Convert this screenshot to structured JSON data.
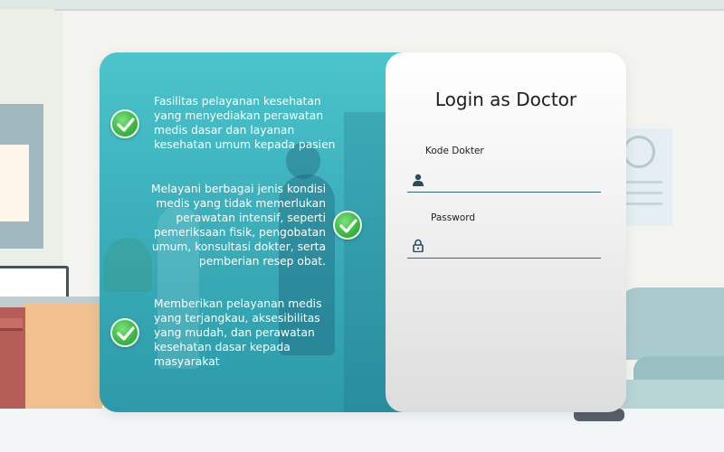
{
  "colors": {
    "info_gradient_top": "#4cc4cb",
    "info_gradient_bottom": "#2d9aa8",
    "check_green": "#3fb844",
    "field_underline": "#2f6b78",
    "icon": "#2e4a5c"
  },
  "info": {
    "features": [
      {
        "text": "Fasilitas pelayanan kesehatan yang menyediakan perawatan medis dasar dan layanan kesehatan umum kepada pasien",
        "icon": "check-circle-icon"
      },
      {
        "text": "Melayani berbagai jenis kondisi medis yang tidak memerlukan perawatan intensif, seperti pemeriksaan fisik, pengobatan umum, konsultasi dokter, serta pemberian resep obat.",
        "icon": "check-circle-icon"
      },
      {
        "text": "Memberikan pelayanan medis yang terjangkau, aksesibilitas yang mudah, dan perawatan kesehatan dasar kepada masyarakat",
        "icon": "check-circle-icon"
      }
    ]
  },
  "login": {
    "title": "Login as Doctor",
    "doctor_code": {
      "label": "Kode Dokter",
      "value": "",
      "placeholder": "",
      "icon": "user-icon"
    },
    "password": {
      "label": "Password",
      "value": "",
      "placeholder": "",
      "icon": "lock-icon"
    }
  }
}
